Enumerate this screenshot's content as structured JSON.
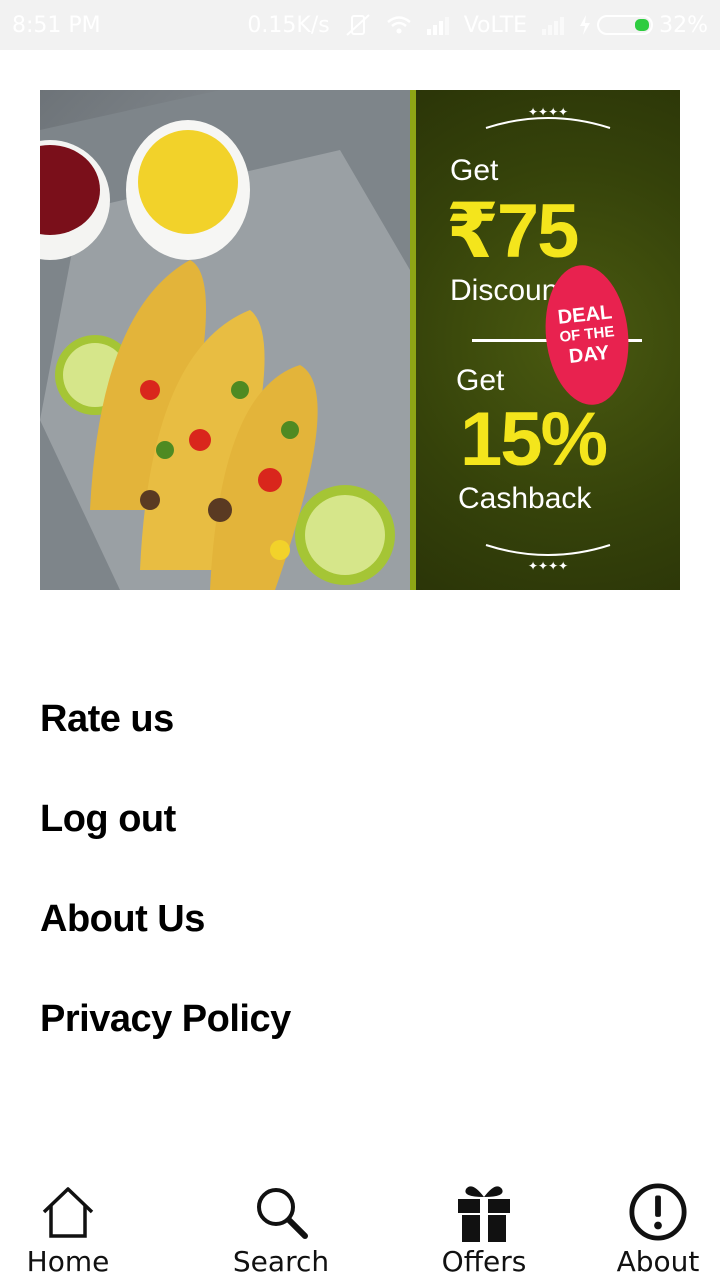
{
  "status_bar": {
    "time": "8:51 PM",
    "speed": "0.15K/s",
    "network": "VoLTE",
    "battery": "32%"
  },
  "banner": {
    "get_label_1": "Get",
    "discount_amount": "₹75",
    "discount_label": "Discount",
    "badge_line1": "DEAL",
    "badge_line2": "OF THE",
    "badge_line3": "DAY",
    "get_label_2": "Get",
    "cashback_amount": "15%",
    "cashback_label": "Cashback"
  },
  "menu": {
    "items": [
      {
        "label": "Rate us"
      },
      {
        "label": "Log out"
      },
      {
        "label": "About Us"
      },
      {
        "label": "Privacy Policy"
      }
    ]
  },
  "bottom_nav": {
    "items": [
      {
        "label": "Home",
        "icon": "home-icon"
      },
      {
        "label": "Search",
        "icon": "search-icon"
      },
      {
        "label": "Offers",
        "icon": "gift-icon"
      },
      {
        "label": "About",
        "icon": "info-icon"
      }
    ]
  },
  "colors": {
    "status_bar_bg": "#f2f2f2",
    "banner_green": "#35420a",
    "badge_red": "#e8224f",
    "accent_yellow": "#f4e51c"
  }
}
